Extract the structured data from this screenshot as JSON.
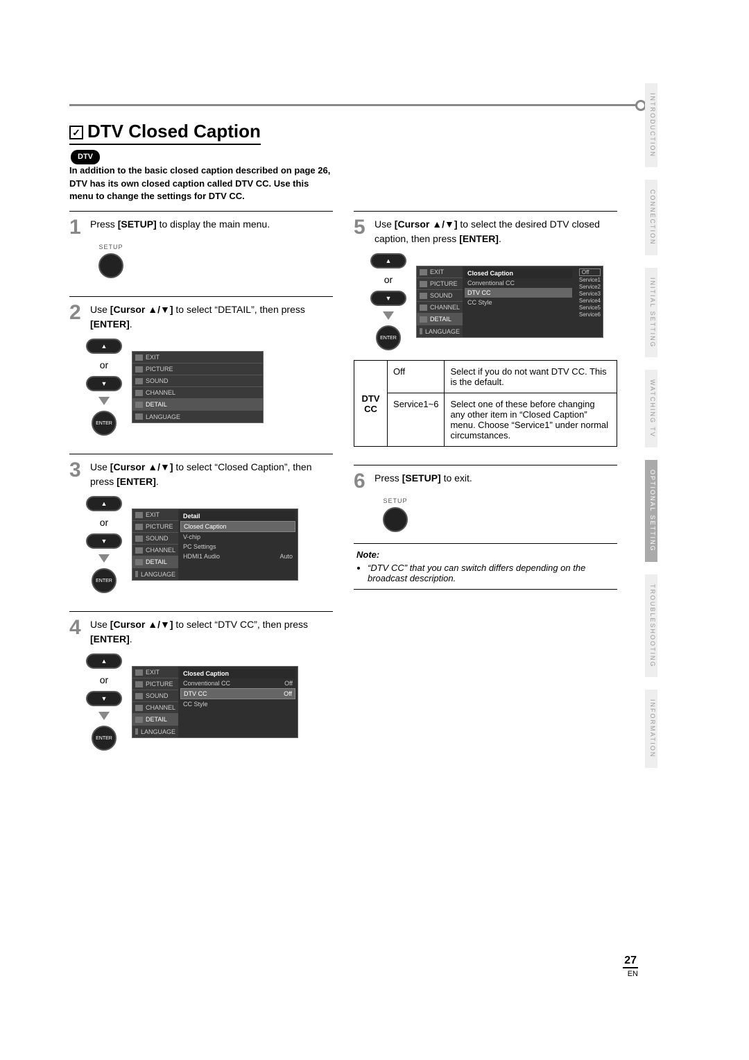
{
  "title": "DTV Closed Caption",
  "dtv_badge": "DTV",
  "intro": "In addition to the basic closed caption described on page 26, DTV has its own closed caption called DTV CC. Use this menu to change the settings for DTV CC.",
  "or_label": "or",
  "setup_label": "SETUP",
  "enter_label": "ENTER",
  "steps": {
    "s1": {
      "num": "1",
      "text_a": "Press ",
      "b1": "[SETUP]",
      "text_b": " to display the main menu."
    },
    "s2": {
      "num": "2",
      "text_a": "Use ",
      "b1": "[Cursor ▲/▼]",
      "text_b": " to select “DETAIL”, then press ",
      "b2": "[ENTER]",
      "text_c": "."
    },
    "s3": {
      "num": "3",
      "text_a": "Use ",
      "b1": "[Cursor ▲/▼]",
      "text_b": " to select “Closed Caption”, then press ",
      "b2": "[ENTER]",
      "text_c": "."
    },
    "s4": {
      "num": "4",
      "text_a": "Use ",
      "b1": "[Cursor ▲/▼]",
      "text_b": " to select “DTV CC”, then press ",
      "b2": "[ENTER]",
      "text_c": "."
    },
    "s5": {
      "num": "5",
      "text_a": "Use ",
      "b1": "[Cursor ▲/▼]",
      "text_b": " to select the desired DTV closed caption, then press ",
      "b2": "[ENTER]",
      "text_c": "."
    },
    "s6": {
      "num": "6",
      "text_a": "Press ",
      "b1": "[SETUP]",
      "text_b": " to exit."
    }
  },
  "osd_tabs": {
    "exit": "EXIT",
    "picture": "PICTURE",
    "sound": "SOUND",
    "channel": "CHANNEL",
    "detail": "DETAIL",
    "language": "LANGUAGE"
  },
  "osd3": {
    "title": "Detail",
    "i1": "Closed Caption",
    "i2": "V-chip",
    "i3": "PC Settings",
    "i4": "HDMI1 Audio",
    "v4": "Auto"
  },
  "osd4": {
    "title": "Closed Caption",
    "i1": "Conventional CC",
    "v1": "Off",
    "i2": "DTV CC",
    "v2": "Off",
    "i3": "CC Style"
  },
  "osd5": {
    "title": "Closed Caption",
    "i1": "Conventional CC",
    "i2": "DTV CC",
    "i3": "CC Style",
    "opts": [
      "Off",
      "Service1",
      "Service2",
      "Service3",
      "Service4",
      "Service5",
      "Service6"
    ]
  },
  "table": {
    "header": "DTV CC",
    "row1_k": "Off",
    "row1_v": "Select if you do not want DTV CC. This is the default.",
    "row2_k": "Service1~6",
    "row2_v": "Select one of these before changing any other item in “Closed Caption” menu. Choose “Service1” under normal circumstances."
  },
  "note": {
    "heading": "Note:",
    "item": "“DTV CC” that you can switch differs depending on the broadcast description."
  },
  "sidetabs": {
    "t1": "INTRODUCTION",
    "t2": "CONNECTION",
    "t3": "INITIAL SETTING",
    "t4": "WATCHING TV",
    "t5": "OPTIONAL SETTING",
    "t6": "TROUBLESHOOTING",
    "t7": "INFORMATION"
  },
  "page_number": "27",
  "page_lang": "EN"
}
